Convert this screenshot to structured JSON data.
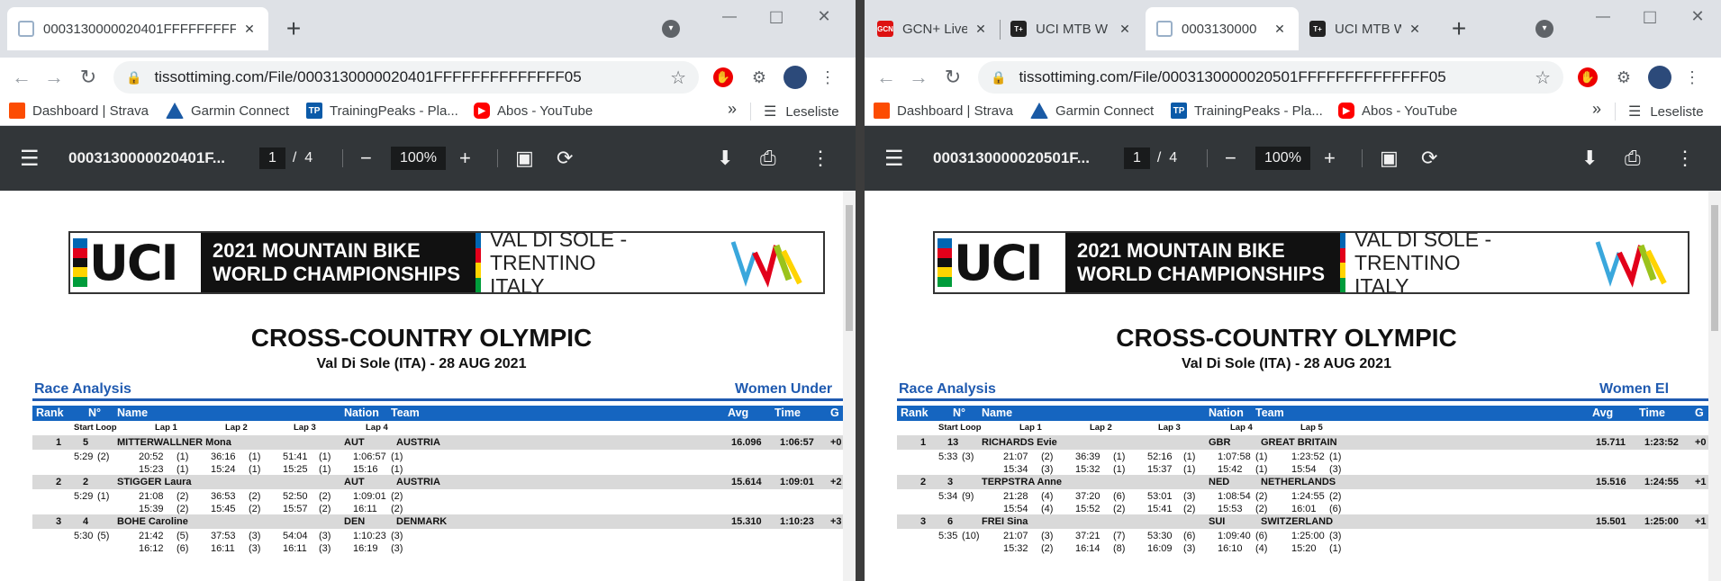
{
  "left": {
    "tabs": [
      {
        "title": "0003130000020401FFFFFFFFFFFFFF05",
        "favicon": "doc-icon",
        "active": true
      }
    ],
    "url": "tissottiming.com/File/0003130000020401FFFFFFFFFFFFFF05",
    "pdf": {
      "filename": "0003130000020401F...",
      "page": "1",
      "page_sep": "/",
      "total_pages": "4",
      "zoom": "100%"
    },
    "section_right": "Women Under",
    "lap_labels": [
      "Start Loop",
      "Lap 1",
      "Lap 2",
      "Lap 3",
      "Lap 4"
    ],
    "rows": [
      {
        "rank": "1",
        "bib": "5",
        "name": "MITTERWALLNER Mona",
        "nation": "AUT",
        "team": "AUSTRIA",
        "avg": "16.096",
        "time": "1:06:57",
        "gap": "+0",
        "line1": [
          "5:29",
          "(2)",
          "20:52",
          "(1)",
          "36:16",
          "(1)",
          "51:41",
          "(1)",
          "1:06:57",
          "(1)"
        ],
        "line2": [
          "15:23",
          "(1)",
          "15:24",
          "(1)",
          "15:25",
          "(1)",
          "15:16",
          "(1)"
        ]
      },
      {
        "rank": "2",
        "bib": "2",
        "name": "STIGGER Laura",
        "nation": "AUT",
        "team": "AUSTRIA",
        "avg": "15.614",
        "time": "1:09:01",
        "gap": "+2",
        "line1": [
          "5:29",
          "(1)",
          "21:08",
          "(2)",
          "36:53",
          "(2)",
          "52:50",
          "(2)",
          "1:09:01",
          "(2)"
        ],
        "line2": [
          "15:39",
          "(2)",
          "15:45",
          "(2)",
          "15:57",
          "(2)",
          "16:11",
          "(2)"
        ]
      },
      {
        "rank": "3",
        "bib": "4",
        "name": "BOHE Caroline",
        "nation": "DEN",
        "team": "DENMARK",
        "avg": "15.310",
        "time": "1:10:23",
        "gap": "+3",
        "line1": [
          "5:30",
          "(5)",
          "21:42",
          "(5)",
          "37:53",
          "(3)",
          "54:04",
          "(3)",
          "1:10:23",
          "(3)"
        ],
        "line2": [
          "16:12",
          "(6)",
          "16:11",
          "(3)",
          "16:11",
          "(3)",
          "16:19",
          "(3)"
        ]
      }
    ]
  },
  "right": {
    "tabs": [
      {
        "title": "GCN+ Live",
        "favicon": "gcn-icon",
        "active": false
      },
      {
        "title": "UCI MTB W",
        "favicon": "tplus-icon",
        "active": false
      },
      {
        "title": "0003130000",
        "favicon": "doc-icon",
        "active": true
      },
      {
        "title": "UCI MTB W",
        "favicon": "tplus-icon",
        "active": false
      }
    ],
    "url": "tissottiming.com/File/0003130000020501FFFFFFFFFFFFFF05",
    "pdf": {
      "filename": "0003130000020501F...",
      "page": "1",
      "page_sep": "/",
      "total_pages": "4",
      "zoom": "100%"
    },
    "section_right": "Women El",
    "lap_labels": [
      "Start Loop",
      "Lap 1",
      "Lap 2",
      "Lap 3",
      "Lap 4",
      "Lap 5"
    ],
    "rows": [
      {
        "rank": "1",
        "bib": "13",
        "name": "RICHARDS Evie",
        "nation": "GBR",
        "team": "GREAT BRITAIN",
        "avg": "15.711",
        "time": "1:23:52",
        "gap": "+0",
        "line1": [
          "5:33",
          "(3)",
          "21:07",
          "(2)",
          "36:39",
          "(1)",
          "52:16",
          "(1)",
          "1:07:58",
          "(1)",
          "1:23:52",
          "(1)"
        ],
        "line2": [
          "15:34",
          "(3)",
          "15:32",
          "(1)",
          "15:37",
          "(1)",
          "15:42",
          "(1)",
          "15:54",
          "(3)"
        ]
      },
      {
        "rank": "2",
        "bib": "3",
        "name": "TERPSTRA Anne",
        "nation": "NED",
        "team": "NETHERLANDS",
        "avg": "15.516",
        "time": "1:24:55",
        "gap": "+1",
        "line1": [
          "5:34",
          "(9)",
          "21:28",
          "(4)",
          "37:20",
          "(6)",
          "53:01",
          "(3)",
          "1:08:54",
          "(2)",
          "1:24:55",
          "(2)"
        ],
        "line2": [
          "15:54",
          "(4)",
          "15:52",
          "(2)",
          "15:41",
          "(2)",
          "15:53",
          "(2)",
          "16:01",
          "(6)"
        ]
      },
      {
        "rank": "3",
        "bib": "6",
        "name": "FREI Sina",
        "nation": "SUI",
        "team": "SWITZERLAND",
        "avg": "15.501",
        "time": "1:25:00",
        "gap": "+1",
        "line1": [
          "5:35",
          "(10)",
          "21:07",
          "(3)",
          "37:21",
          "(7)",
          "53:30",
          "(6)",
          "1:09:40",
          "(6)",
          "1:25:00",
          "(3)"
        ],
        "line2": [
          "15:32",
          "(2)",
          "16:14",
          "(8)",
          "16:09",
          "(3)",
          "16:10",
          "(4)",
          "15:20",
          "(1)"
        ]
      }
    ]
  },
  "bookmarks": [
    {
      "label": "Dashboard | Strava",
      "icon": "strava-icon",
      "color": "#fc4c02"
    },
    {
      "label": "Garmin Connect",
      "icon": "garmin-icon",
      "color": "#1a5aa5"
    },
    {
      "label": "TrainingPeaks - Pla...",
      "icon": "trainingpeaks-icon",
      "color": "#0b5aa8"
    },
    {
      "label": "Abos - YouTube",
      "icon": "youtube-icon",
      "color": "#ff0000"
    }
  ],
  "bookmarks_overflow": "»",
  "reading_list": "Leseliste",
  "doc": {
    "banner_uci": "UCI",
    "banner_line1": "2021 MOUNTAIN BIKE",
    "banner_line2": "WORLD CHAMPIONSHIPS",
    "banner_venue1": "VAL DI SOLE - TRENTINO",
    "banner_venue2": "ITALY",
    "title": "CROSS-COUNTRY OLYMPIC",
    "subtitle": "Val Di Sole (ITA) - 28 AUG 2021",
    "section_left": "Race Analysis"
  },
  "columns": {
    "rank": "Rank",
    "bib": "N°",
    "name": "Name",
    "nation": "Nation",
    "team": "Team",
    "avg": "Avg",
    "time": "Time",
    "gap": "G"
  },
  "colors": {
    "tab_bg": "#dee1e6",
    "pdf_toolbar": "#323639",
    "table_header": "#1565c0",
    "section_blue": "#1f5ab0"
  }
}
